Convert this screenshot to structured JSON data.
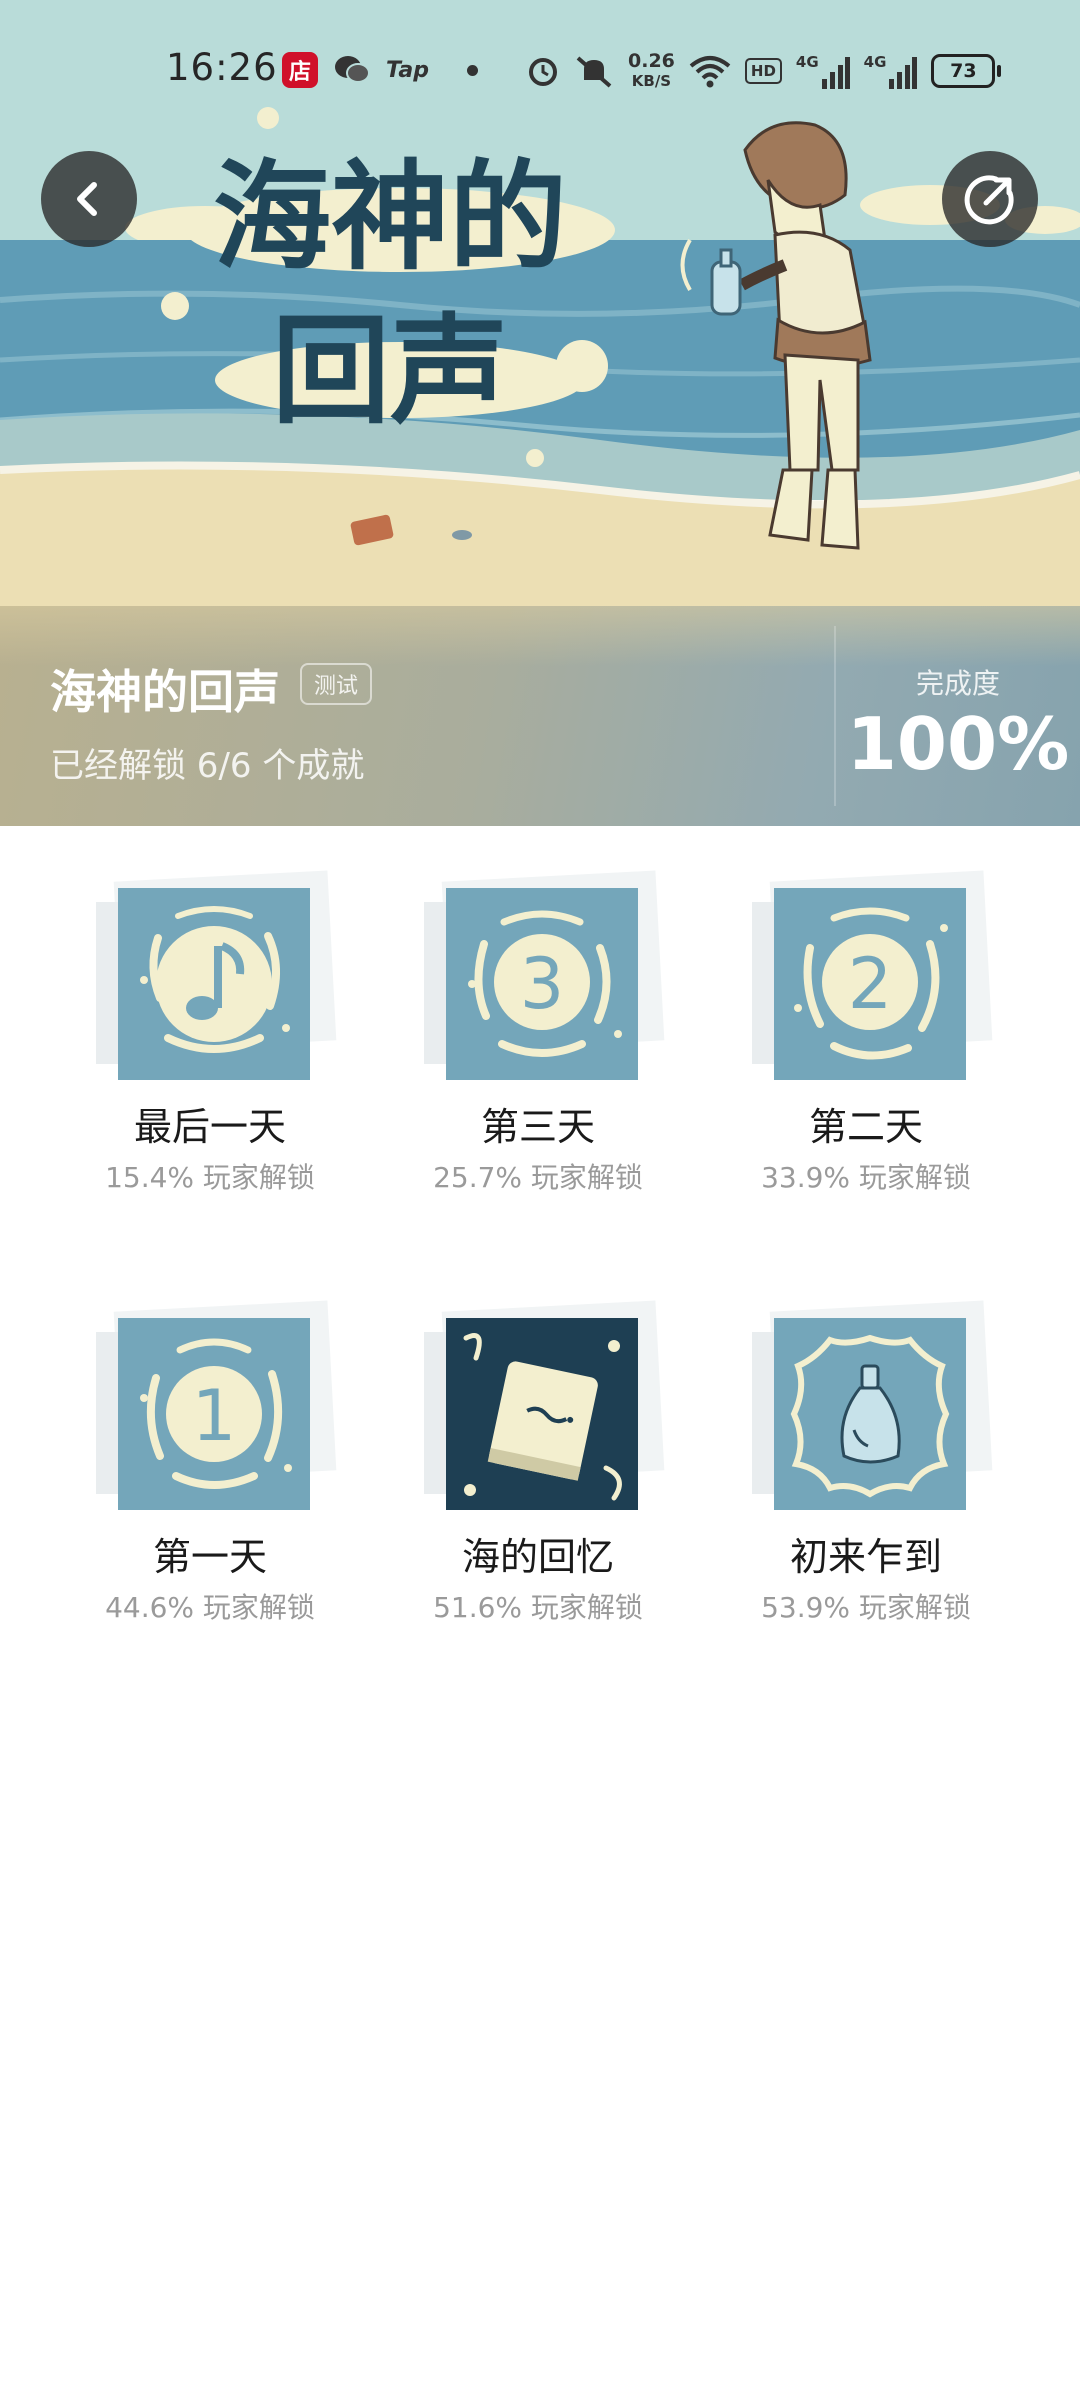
{
  "status_bar": {
    "time": "16:26",
    "store_badge": "店",
    "tap_label": "Tap",
    "net_speed_value": "0.26",
    "net_speed_unit": "KB/S",
    "hd_label": "HD",
    "net1_label": "4G",
    "net2_label": "4G",
    "battery": "73"
  },
  "header": {
    "art_title_line1": "海神的",
    "art_title_line2": "回声",
    "back_icon": "chevron-left-icon",
    "share_icon": "share-icon"
  },
  "game": {
    "title": "海神的回声",
    "tag": "测试",
    "unlock_summary": "已经解锁 6/6 个成就",
    "progress_label": "完成度",
    "progress_value": "100%"
  },
  "achievements": [
    {
      "name": "最后一天",
      "rate": "15.4% 玩家解锁",
      "icon": "music-note-icon"
    },
    {
      "name": "第三天",
      "rate": "25.7% 玩家解锁",
      "icon": "number-three-icon"
    },
    {
      "name": "第二天",
      "rate": "33.9% 玩家解锁",
      "icon": "number-two-icon"
    },
    {
      "name": "第一天",
      "rate": "44.6% 玩家解锁",
      "icon": "number-one-icon"
    },
    {
      "name": "海的回忆",
      "rate": "51.6% 玩家解锁",
      "icon": "book-icon"
    },
    {
      "name": "初来乍到",
      "rate": "53.9% 玩家解锁",
      "icon": "bottle-icon"
    }
  ],
  "colors": {
    "icon_bg": "#74a6ba",
    "icon_dark_bg": "#1e3f53",
    "icon_cream": "#f3efcf",
    "sea": "#5f9cb6",
    "sky": "#b9dcd9",
    "sand": "#ecdfb4"
  }
}
